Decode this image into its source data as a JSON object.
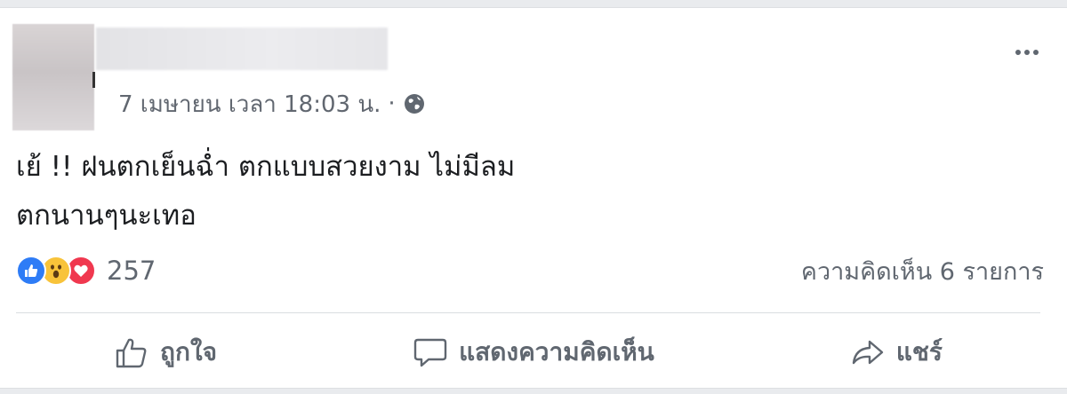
{
  "post": {
    "timestamp": "7 เมษายน เวลา 18:03 น.",
    "separator": "·",
    "audience_icon": "globe-icon",
    "text_lines": [
      "เย้ !! ฝนตกเย็นฉ่ำ ตกแบบสวยงาม ไม่มีลม",
      "ตกนานๆนะเทอ"
    ]
  },
  "reactions": {
    "icons": [
      "like-reaction-icon",
      "wow-reaction-icon",
      "love-reaction-icon"
    ],
    "count": "257",
    "colors": {
      "like": "#2e7cf6",
      "wow": "#f8c33a",
      "love": "#f0384f"
    }
  },
  "comments_summary": "ความคิดเห็น 6 รายการ",
  "actions": {
    "like_label": "ถูกใจ",
    "comment_label": "แสดงความคิดเห็น",
    "share_label": "แชร์"
  },
  "more_menu_icon": "more-options-icon"
}
